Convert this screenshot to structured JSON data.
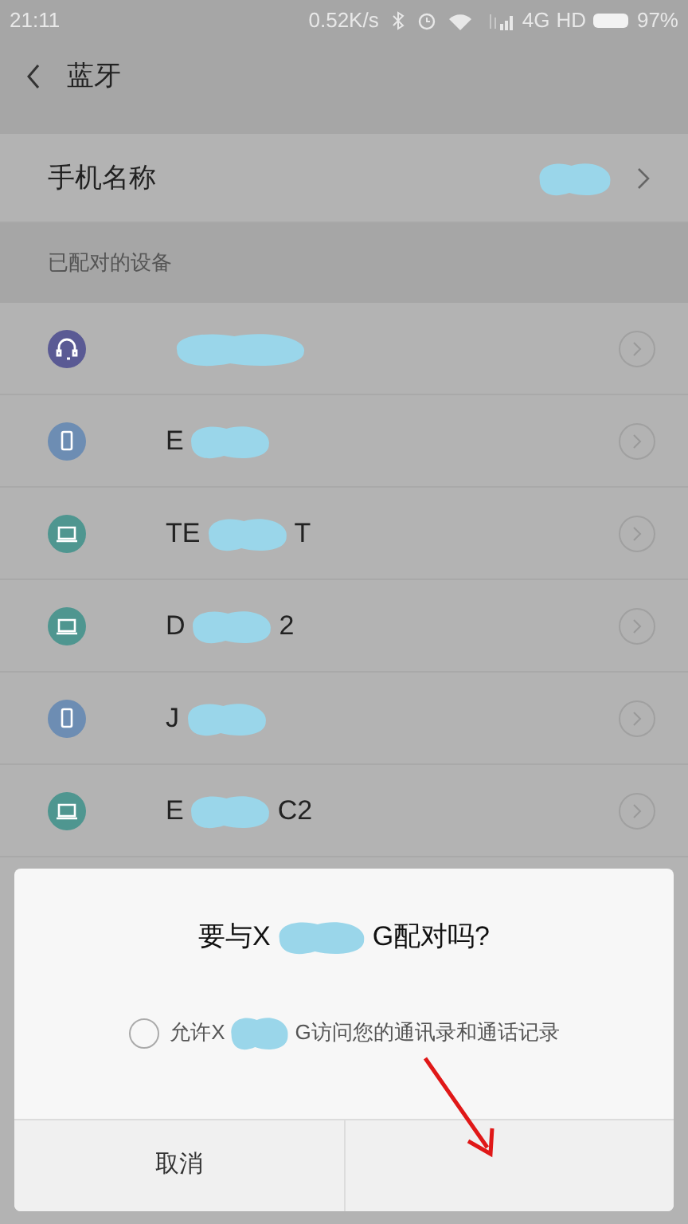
{
  "status_bar": {
    "time": "21:11",
    "speed": "0.52K/s",
    "network": "4G",
    "hd": "HD",
    "battery": "97%"
  },
  "header": {
    "title": "蓝牙"
  },
  "phone_name": {
    "label": "手机名称"
  },
  "section_title": "已配对的设备",
  "devices": [
    {
      "kind": "headset",
      "color": "#5a5a94"
    },
    {
      "kind": "phone",
      "color": "#6d8db3",
      "name_start": "E"
    },
    {
      "kind": "laptop",
      "color": "#4f9690",
      "name_start": "TE",
      "name_end": "T"
    },
    {
      "kind": "laptop",
      "color": "#4f9690",
      "name_start": "D",
      "name_end": "2"
    },
    {
      "kind": "phone",
      "color": "#6d8db3",
      "name_start": "J"
    },
    {
      "kind": "laptop",
      "color": "#4f9690",
      "name_start": "E",
      "name_end": "C2"
    }
  ],
  "dialog": {
    "title_start": "要与X",
    "title_end": "G配对吗?",
    "option": {
      "label_start": "允许X",
      "label_end": "G访问您的通讯录和通话记录",
      "checked": false
    },
    "cancel": "取消"
  }
}
